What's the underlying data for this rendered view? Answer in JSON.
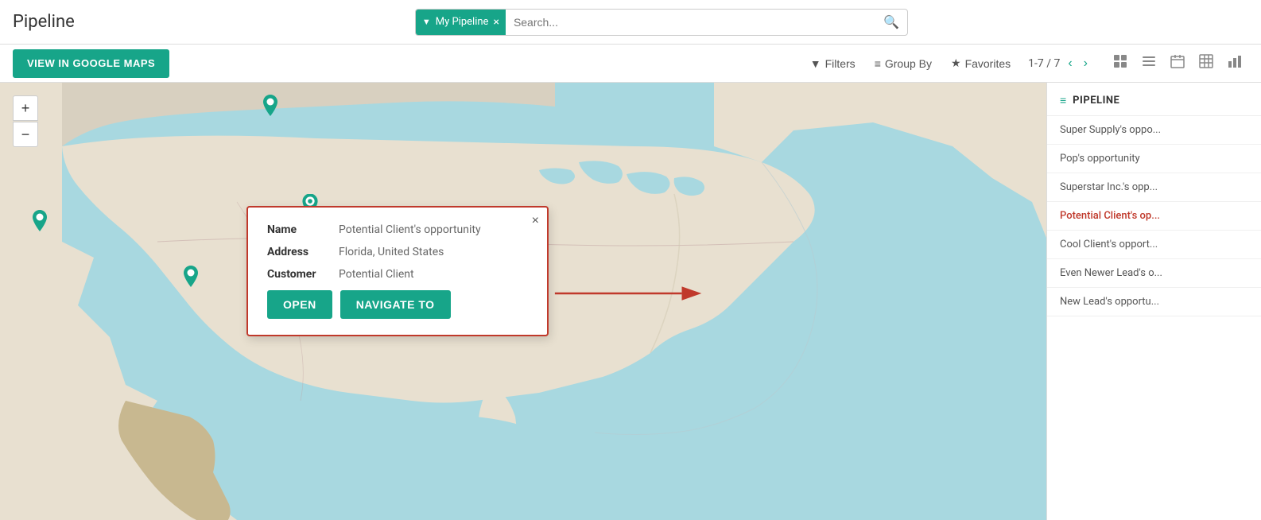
{
  "app": {
    "title": "Pipeline"
  },
  "header": {
    "filter_tag_label": "My Pipeline",
    "filter_tag_icon": "▼",
    "search_placeholder": "Search...",
    "search_icon": "🔍"
  },
  "toolbar": {
    "google_maps_btn": "VIEW IN GOOGLE MAPS",
    "filters_label": "Filters",
    "group_by_label": "Group By",
    "favorites_label": "Favorites",
    "pagination_text": "1-7 / 7"
  },
  "popup": {
    "close_label": "×",
    "name_label": "Name",
    "name_value": "Potential Client's opportunity",
    "address_label": "Address",
    "address_value": "Florida, United States",
    "customer_label": "Customer",
    "customer_value": "Potential Client",
    "open_btn": "OPEN",
    "navigate_btn": "NAVIGATE TO"
  },
  "sidebar": {
    "title": "PIPELINE",
    "items": [
      {
        "label": "Super Supply's oppo..."
      },
      {
        "label": "Pop's opportunity"
      },
      {
        "label": "Superstar Inc.'s opp..."
      },
      {
        "label": "Potential Client's op..."
      },
      {
        "label": "Cool Client's opport..."
      },
      {
        "label": "Even Newer Lead's o..."
      },
      {
        "label": "New Lead's opportu..."
      }
    ]
  },
  "map": {
    "plus_label": "+",
    "minus_label": "−"
  },
  "view_icons": {
    "kanban": "⊞",
    "list": "☰",
    "calendar": "📅",
    "grid": "⊟",
    "chart": "📊"
  },
  "colors": {
    "teal": "#17a589",
    "red": "#c0392b"
  }
}
